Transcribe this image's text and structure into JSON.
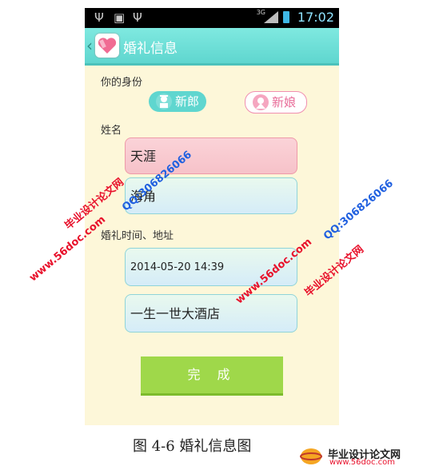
{
  "status_bar": {
    "time": "17:02",
    "network": "3G"
  },
  "action_bar": {
    "title": "婚礼信息",
    "back_icon": "chevron-left-icon",
    "logo_icon": "heart-app-icon"
  },
  "form": {
    "identity_label": "你的身份",
    "groom_label": "新郎",
    "bride_label": "新娘",
    "name_label": "姓名",
    "groom_name": "天涯",
    "bride_name": "海角",
    "time_place_label": "婚礼时间、地址",
    "datetime": "2014-05-20 14:39",
    "place": "一生一世大酒店",
    "submit_label": "完 成"
  },
  "caption": "图 4-6  婚礼信息图",
  "watermarks": {
    "site_cn": "毕业设计论文网",
    "qq": "QQ:306826066",
    "url": "www.56doc.com"
  },
  "footer_logo": {
    "title": "毕业设计论文网",
    "url": "www.56doc.com"
  },
  "colors": {
    "accent": "#5fd6cf",
    "pink": "#f6c2c9",
    "green_button": "#9fd84a",
    "background": "#fdf7d9"
  }
}
